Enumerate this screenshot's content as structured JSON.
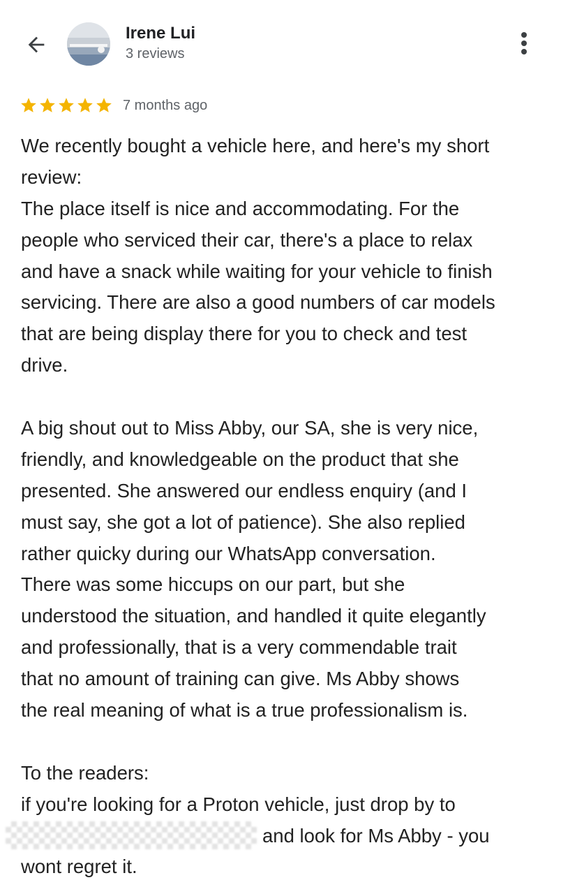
{
  "reviewer": {
    "name": "Irene Lui",
    "review_count": "3 reviews"
  },
  "icons": {
    "back": "arrow-left-icon",
    "more": "more-vert-icon",
    "star": "star-icon"
  },
  "colors": {
    "star": "#F4B400",
    "text": "#222222",
    "secondary": "#5F6368"
  },
  "review": {
    "rating": 5,
    "max_rating": 5,
    "time": "7 months ago",
    "lines": [
      "We recently bought a vehicle here, and here's my short",
      "review:",
      "The place itself is nice and accommodating. For the",
      "people who serviced their car, there's a place to relax",
      "and have a snack while waiting for your vehicle to finish",
      "servicing. There are also a good numbers of car models",
      "that are being display there for you to check and test",
      "drive.",
      "",
      "A big shout out to Miss Abby, our SA, she is very nice,",
      "friendly, and knowledgeable on the product that she",
      "presented. She answered our endless enquiry (and I",
      "must say, she got a lot of patience). She also replied",
      "rather quicky during our WhatsApp conversation.",
      "There was some hiccups on our part, but she",
      "understood the situation, and handled it quite elegantly",
      "and professionally, that is a very commendable trait",
      "that no amount of training can give. Ms Abby shows",
      "the real meaning of what is a true professionalism is.",
      "",
      "To the readers:",
      "if you're looking for a Proton vehicle, just drop by to",
      "and look for Ms Abby - you",
      "wont regret it."
    ]
  }
}
